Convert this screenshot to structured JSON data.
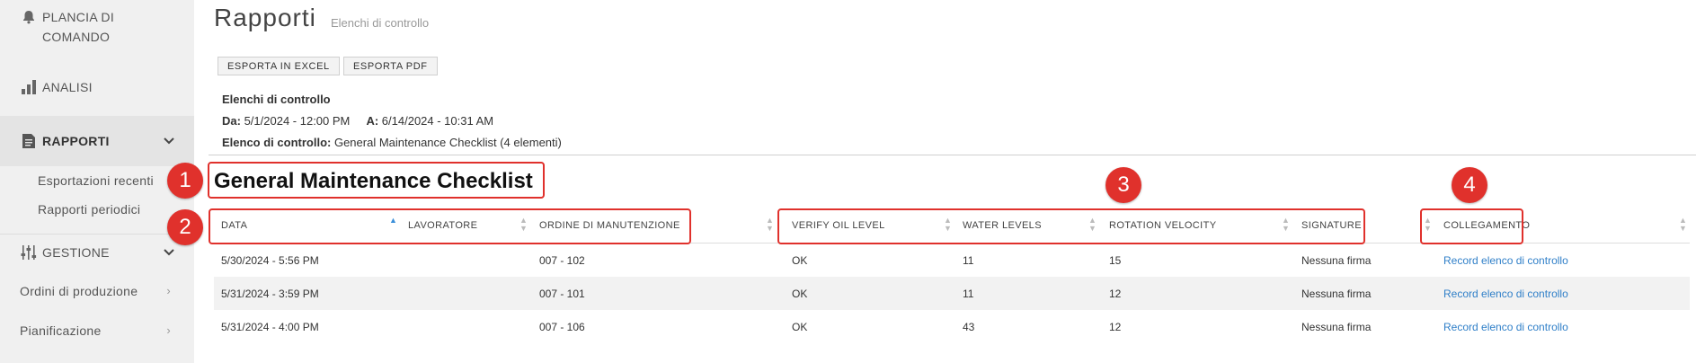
{
  "sidebar": {
    "dashboard": "PLANCIA DI COMANDO",
    "analytics": "ANALISI",
    "reports": "RAPPORTI",
    "reports_sub": [
      "Esportazioni recenti",
      "Rapporti periodici"
    ],
    "management": "GESTIONE",
    "production_orders": "Ordini di produzione",
    "planning": "Pianificazione"
  },
  "header": {
    "title": "Rapporti",
    "subtitle": "Elenchi di controllo"
  },
  "toolbar": {
    "export_excel": "ESPORTA IN EXCEL",
    "export_pdf": "ESPORTA PDF"
  },
  "info": {
    "heading": "Elenchi di controllo",
    "from_label": "Da:",
    "from_value": "5/1/2024 - 12:00 PM",
    "to_label": "A:",
    "to_value": "6/14/2024 - 10:31 AM",
    "checklist_label": "Elenco di controllo:",
    "checklist_value": "General Maintenance Checklist (4 elementi)"
  },
  "section_title": "General Maintenance Checklist",
  "table": {
    "columns": [
      "DATA",
      "LAVORATORE",
      "ORDINE DI MANUTENZIONE",
      "VERIFY OIL LEVEL",
      "WATER LEVELS",
      "ROTATION VELOCITY",
      "SIGNATURE",
      "COLLEGAMENTO"
    ],
    "rows": [
      [
        "5/30/2024 - 5:56 PM",
        "",
        "007 - 102",
        "OK",
        "11",
        "15",
        "Nessuna firma",
        "Record elenco di controllo"
      ],
      [
        "5/31/2024 - 3:59 PM",
        "",
        "007 - 101",
        "OK",
        "11",
        "12",
        "Nessuna firma",
        "Record elenco di controllo"
      ],
      [
        "5/31/2024 - 4:00 PM",
        "",
        "007 - 106",
        "OK",
        "43",
        "12",
        "Nessuna firma",
        "Record elenco di controllo"
      ]
    ]
  },
  "annotations": [
    "1",
    "2",
    "3",
    "4"
  ],
  "colors": {
    "accent": "#e0312c",
    "link": "#2f7fc8",
    "sort_active": "#3a8fd9"
  }
}
